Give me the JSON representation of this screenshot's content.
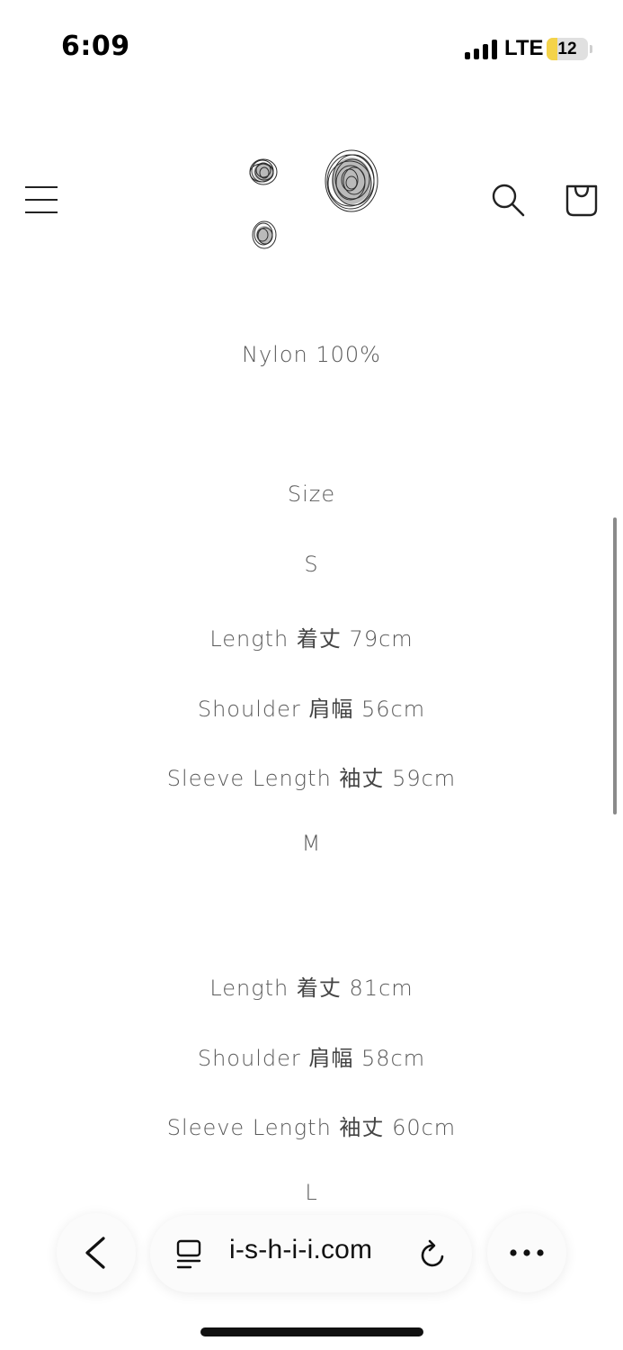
{
  "status_bar": {
    "time": "6:09",
    "network": "LTE",
    "battery": "12",
    "battery_level": 0.12,
    "battery_color": "#f4d34a"
  },
  "header": {
    "menu_icon": "hamburger-menu-icon",
    "logo_icon": "scribble-circles-logo",
    "search_icon": "search-icon",
    "cart_icon": "shopping-bag-icon"
  },
  "product": {
    "material": "Nylon 100%",
    "size_heading": "Size",
    "sizes": [
      {
        "label": "S",
        "length": {
          "en": "Length",
          "jp": "着丈",
          "value": "79cm"
        },
        "shoulder": {
          "en": "Shoulder",
          "jp": "肩幅",
          "value": "56cm"
        },
        "sleeve": {
          "en": "Sleeve Length",
          "jp": "袖丈",
          "value": "59cm"
        }
      },
      {
        "label": "M",
        "length": {
          "en": "Length",
          "jp": "着丈",
          "value": "81cm"
        },
        "shoulder": {
          "en": "Shoulder",
          "jp": "肩幅",
          "value": "58cm"
        },
        "sleeve": {
          "en": "Sleeve Length",
          "jp": "袖丈",
          "value": "60cm"
        }
      },
      {
        "label": "L"
      }
    ]
  },
  "browser_toolbar": {
    "back_icon": "chevron-left-icon",
    "reader_icon": "reader-mode-icon",
    "url": "i-s-h-i-i.com",
    "reload_icon": "reload-icon",
    "more_icon": "more-dots-icon"
  }
}
